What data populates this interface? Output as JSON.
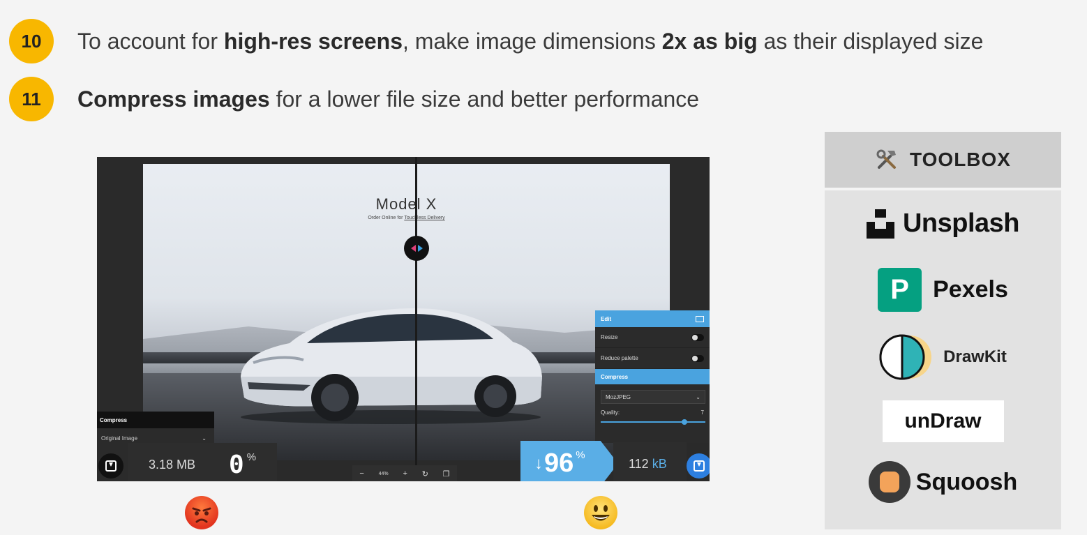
{
  "tips": [
    {
      "number": "10",
      "parts": [
        {
          "text": "To account for ",
          "bold": false
        },
        {
          "text": "high-res screens",
          "bold": true
        },
        {
          "text": ", make image dimensions ",
          "bold": false
        },
        {
          "text": "2x as big",
          "bold": true
        },
        {
          "text": " as their displayed size",
          "bold": false
        }
      ]
    },
    {
      "number": "11",
      "parts": [
        {
          "text": "Compress images",
          "bold": true
        },
        {
          "text": " for a lower file size and better performance",
          "bold": false
        }
      ]
    }
  ],
  "squoosh": {
    "photo_title": "Model X",
    "photo_sub_prefix": "Order Online for ",
    "photo_sub_link": "Touchless Delivery",
    "left_panel": {
      "heading": "Compress",
      "select_value": "Original Image"
    },
    "edit_panel": {
      "heading": "Edit",
      "resize_label": "Resize",
      "reduce_palette_label": "Reduce palette",
      "compress_heading": "Compress",
      "codec": "MozJPEG",
      "quality_label": "Quality:",
      "quality_value": "7"
    },
    "original_size": "3.18 MB",
    "original_percent": "0",
    "percent_sign": "%",
    "zoom_minus": "−",
    "zoom_value": "44",
    "zoom_unit": "%",
    "zoom_plus": "+",
    "savings_arrow": "↓",
    "savings_percent": "96",
    "compressed_size_value": "112",
    "compressed_size_unit": "kB"
  },
  "toolbox": {
    "title": "TOOLBOX",
    "items": [
      "Unsplash",
      "Pexels",
      "DrawKit",
      "unDraw",
      "Squoosh"
    ]
  },
  "colors": {
    "tip_badge": "#f8b700",
    "squoosh_blue": "#4aa3df",
    "pexels_green": "#05a081"
  }
}
